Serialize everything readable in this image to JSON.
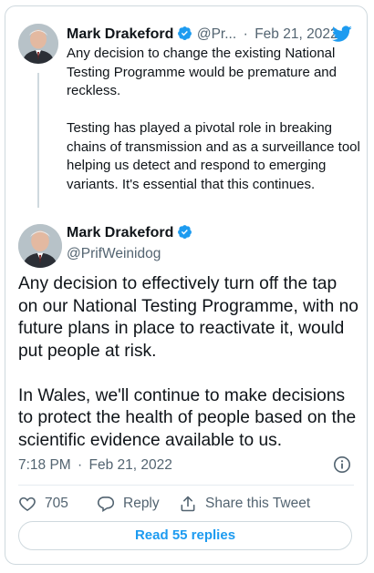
{
  "quoted_tweet": {
    "author_name": "Mark Drakeford",
    "handle": "@Pr...",
    "separator": "·",
    "date": "Feb 21, 2022",
    "text": "Any decision to change the existing National Testing Programme would be premature and reckless.\n\nTesting has played a pivotal role in breaking chains of transmission and as a surveillance tool helping us detect and respond to emerging variants. It's essential that this continues."
  },
  "main_tweet": {
    "author_name": "Mark Drakeford",
    "handle": "@PrifWeinidog",
    "text": "Any decision to effectively turn off the tap on our National Testing Programme, with no future plans in place to reactivate it, would put people at risk.\n\nIn Wales, we'll continue to make decisions to protect the health of people based on the scientific evidence available to us.",
    "time": "7:18 PM",
    "separator": "·",
    "date": "Feb 21, 2022"
  },
  "actions": {
    "like_count": "705",
    "reply_label": "Reply",
    "share_label": "Share this Tweet"
  },
  "read_replies_label": "Read 55 replies",
  "colors": {
    "accent": "#1d9bf0",
    "muted_text": "#536471",
    "border": "#cfd9de"
  },
  "icons": [
    "twitter-bird-icon",
    "verified-badge-icon",
    "info-icon",
    "heart-icon",
    "reply-icon",
    "share-icon"
  ]
}
